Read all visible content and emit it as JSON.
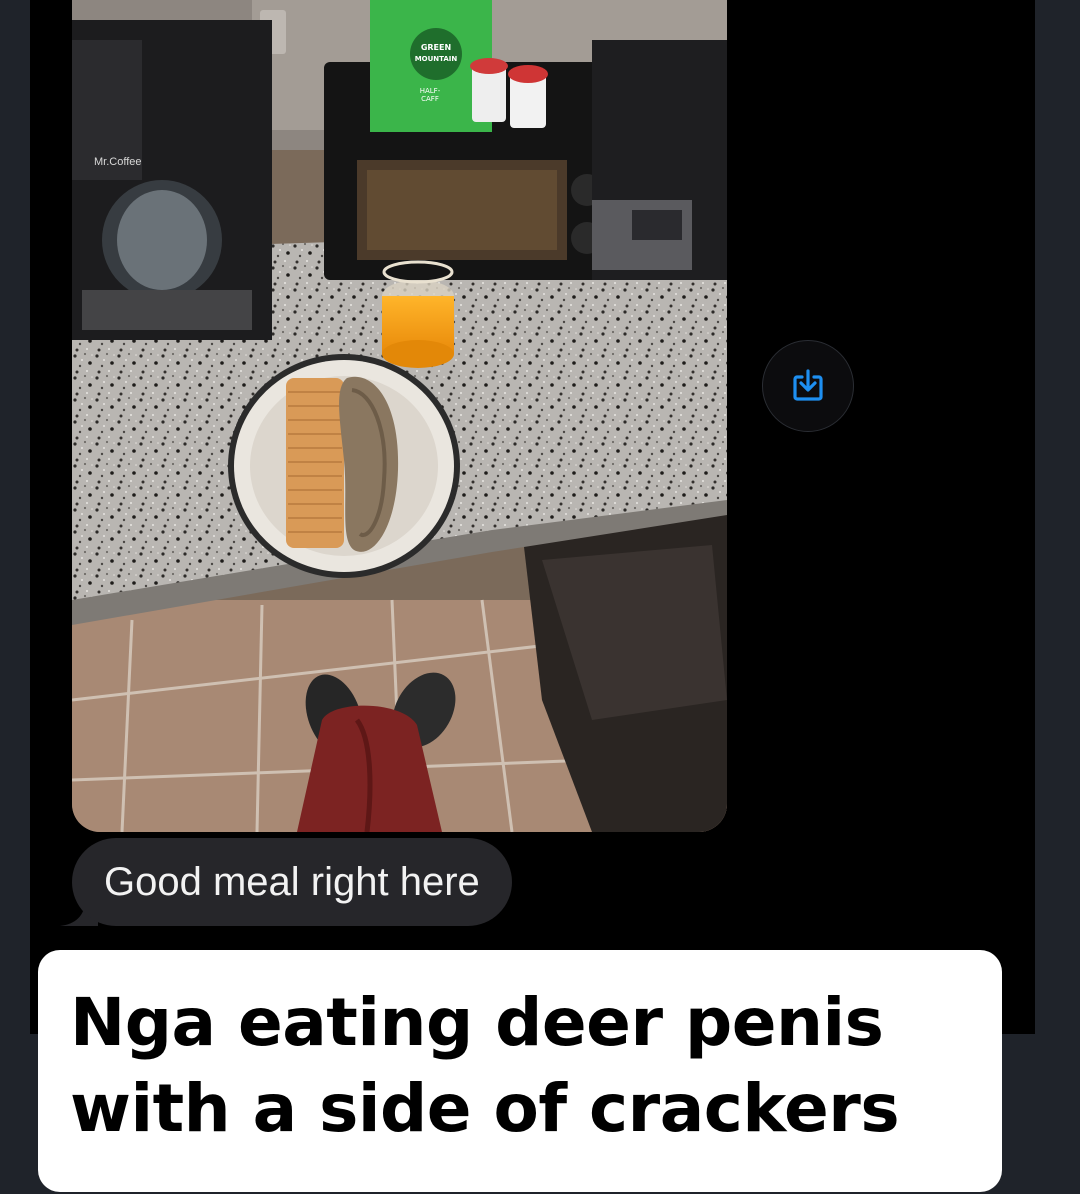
{
  "conversation": {
    "photo": {
      "alt": "",
      "package_text": [
        "GREEN",
        "MOUNTAIN",
        "HALF-",
        "CAFF"
      ],
      "appliance_label": "Mr.Coffee"
    },
    "save_button": {
      "icon": "save-download-icon",
      "color": "#1e8ff0"
    },
    "message": {
      "text": "Good meal right here",
      "bubble_color": "#26262a"
    }
  },
  "caption": {
    "line1": "Nga eating deer penis",
    "line2": "with a side of crackers"
  }
}
